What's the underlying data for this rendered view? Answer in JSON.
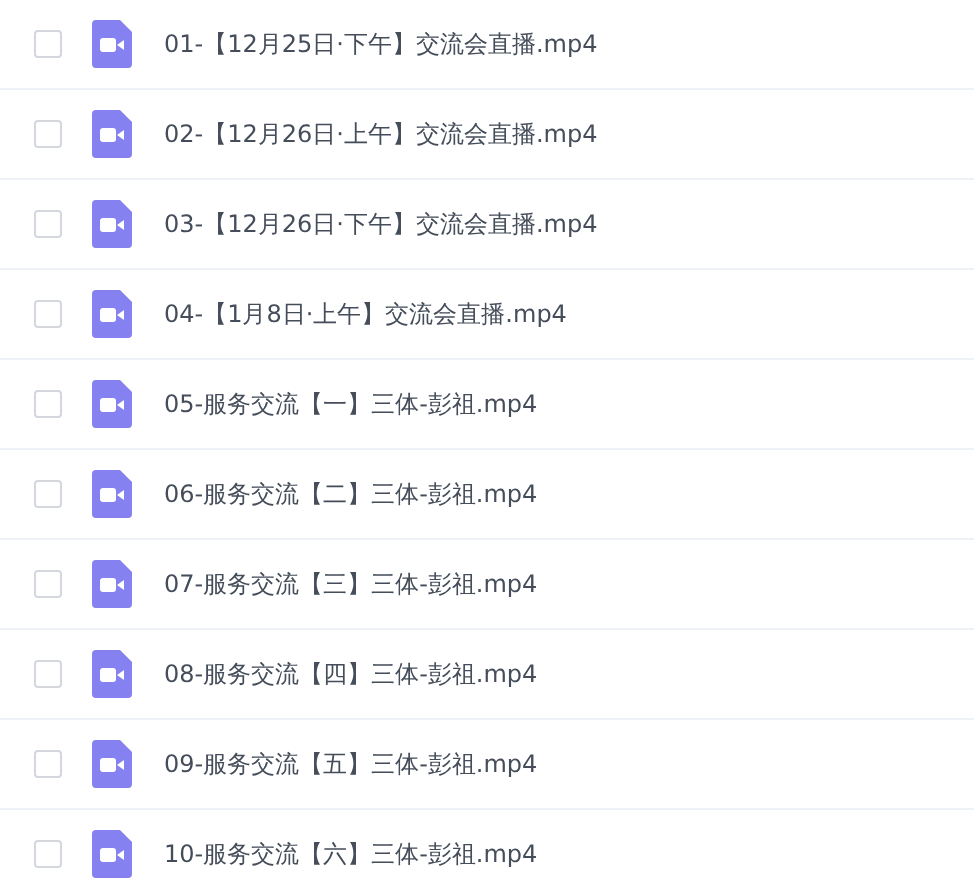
{
  "files": [
    {
      "name": "01-【12月25日·下午】交流会直播.mp4",
      "checked": false
    },
    {
      "name": "02-【12月26日·上午】交流会直播.mp4",
      "checked": false
    },
    {
      "name": "03-【12月26日·下午】交流会直播.mp4",
      "checked": false
    },
    {
      "name": "04-【1月8日·上午】交流会直播.mp4",
      "checked": false
    },
    {
      "name": "05-服务交流【一】三体-彭祖.mp4",
      "checked": false
    },
    {
      "name": "06-服务交流【二】三体-彭祖.mp4",
      "checked": false
    },
    {
      "name": "07-服务交流【三】三体-彭祖.mp4",
      "checked": false
    },
    {
      "name": "08-服务交流【四】三体-彭祖.mp4",
      "checked": false
    },
    {
      "name": "09-服务交流【五】三体-彭祖.mp4",
      "checked": false
    },
    {
      "name": "10-服务交流【六】三体-彭祖.mp4",
      "checked": false
    }
  ]
}
